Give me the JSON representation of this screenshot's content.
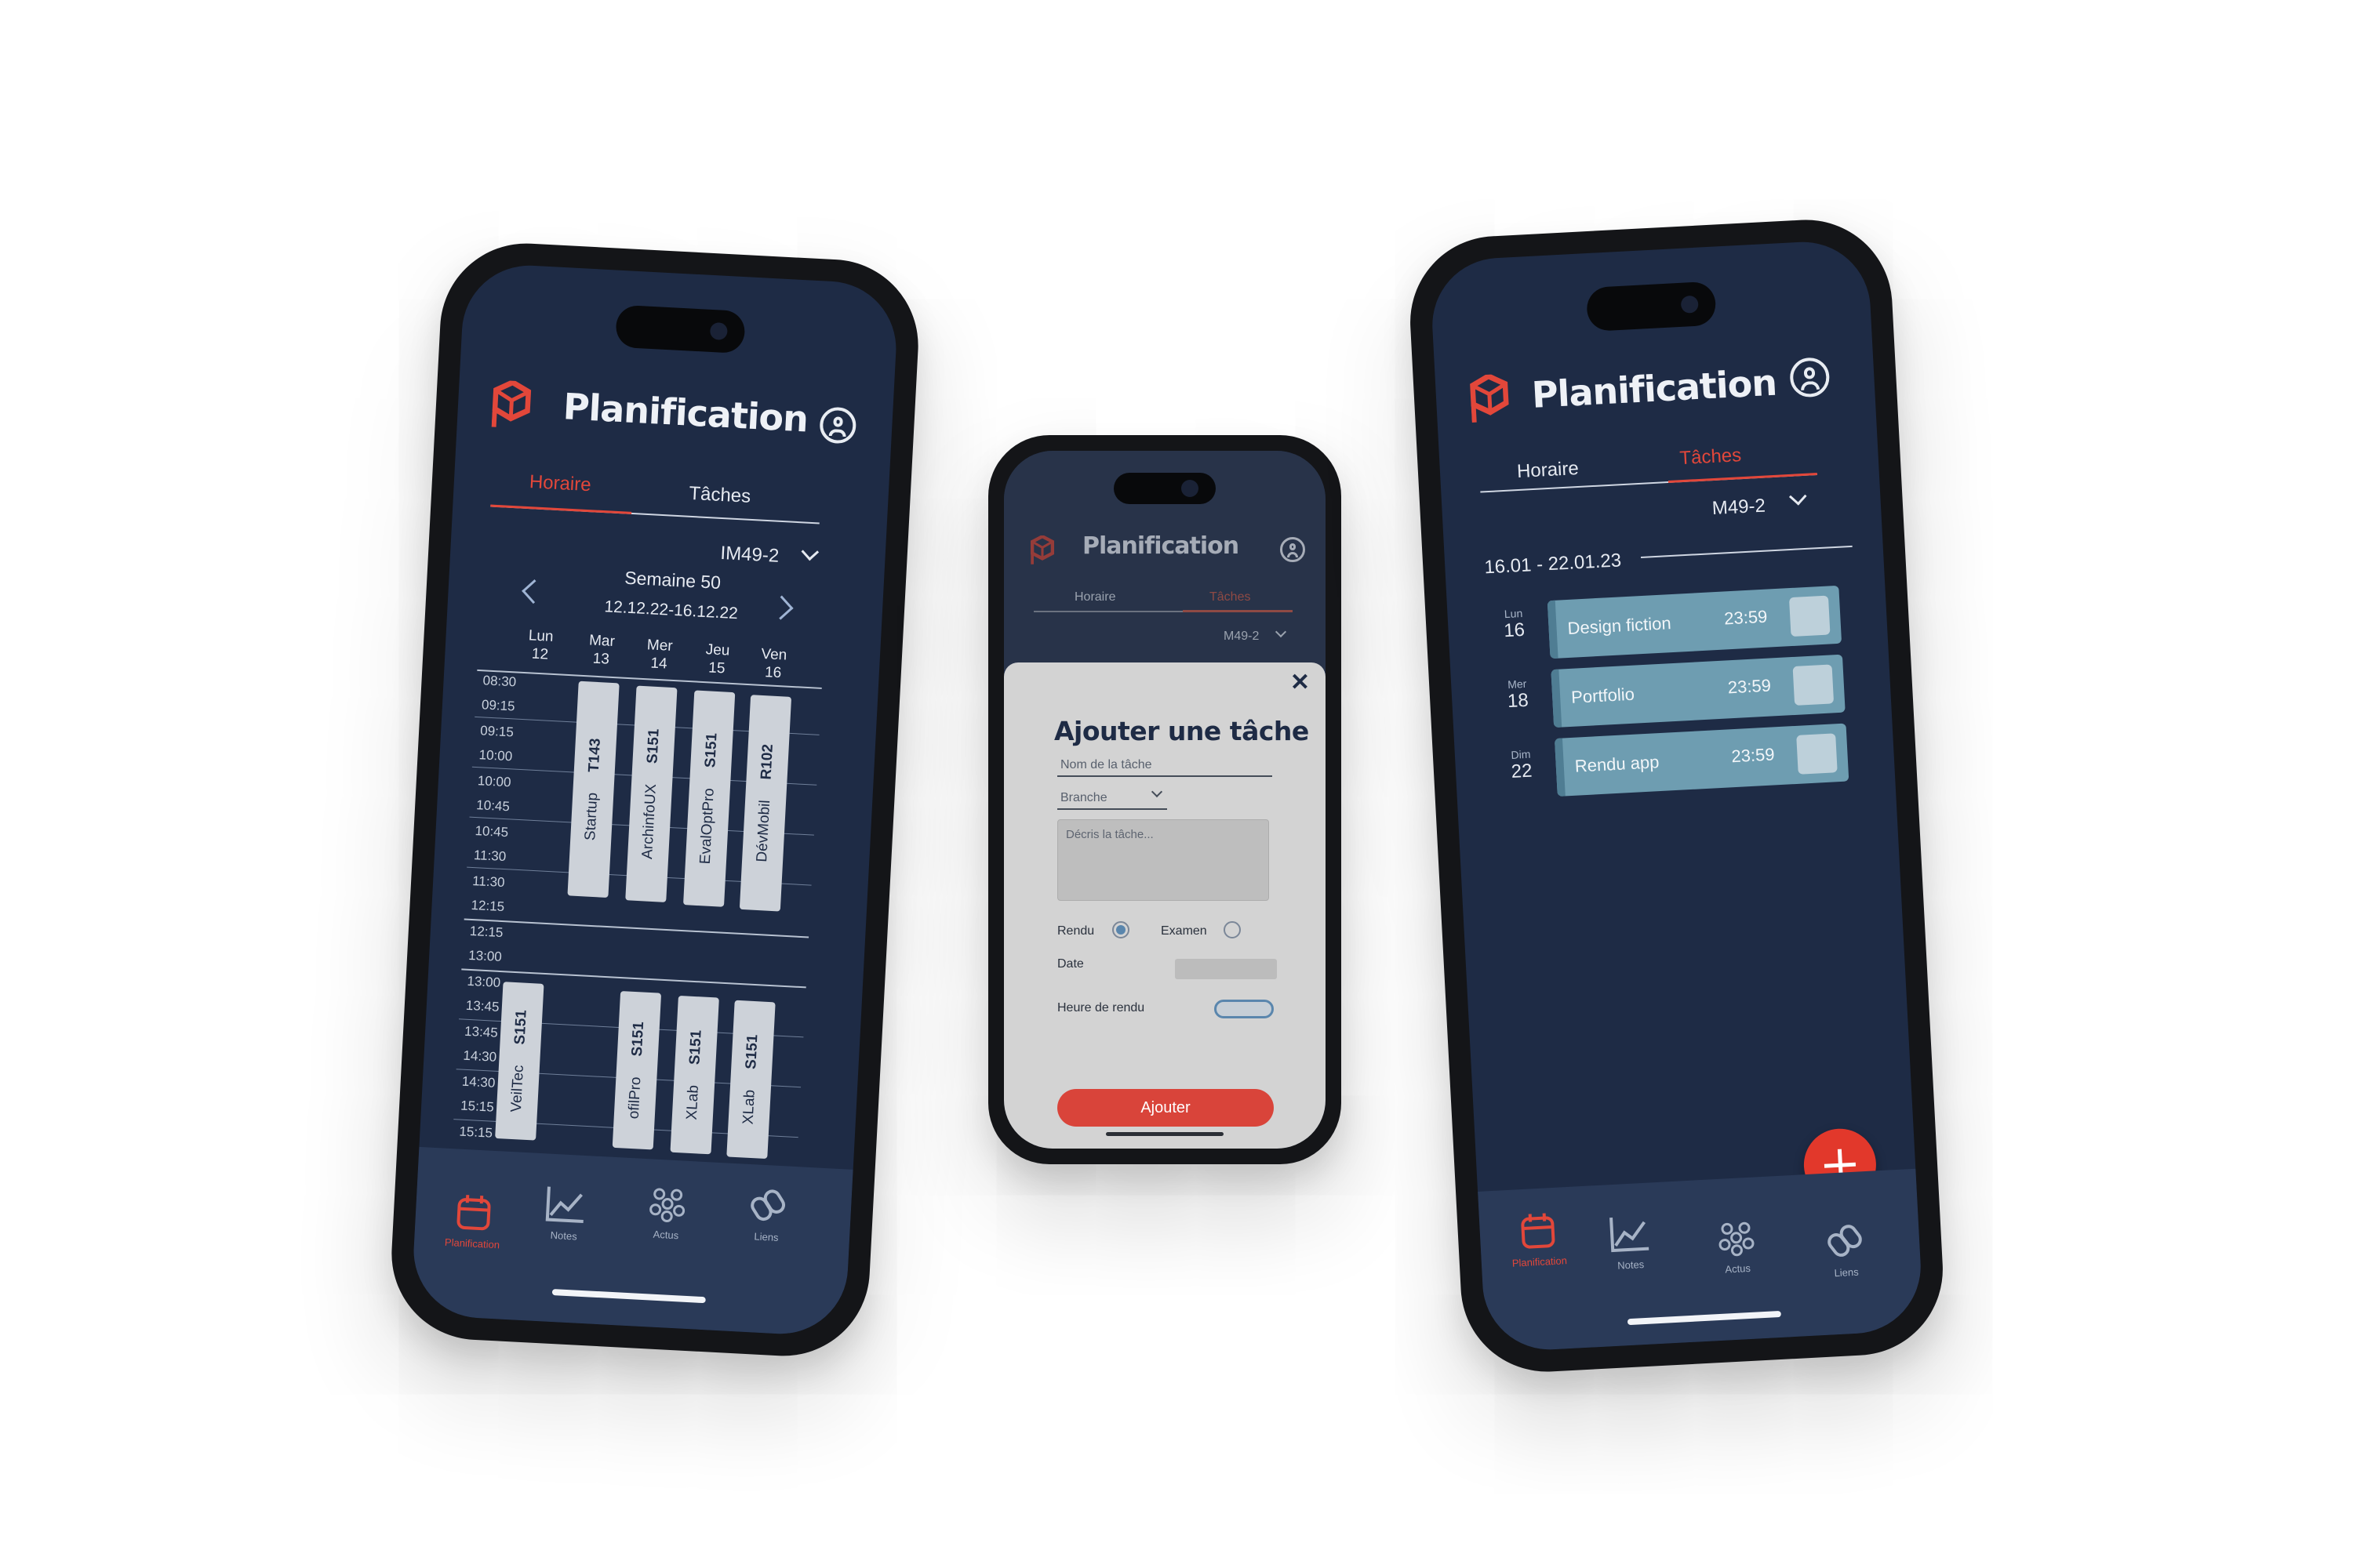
{
  "app": {
    "title": "Planification",
    "brand_color": "#e2473a",
    "background_color": "#1e2b45",
    "logo_icon": "cube-logo-icon",
    "profile_icon": "profile-icon"
  },
  "tabs": {
    "horaire": "Horaire",
    "taches": "Tâches"
  },
  "class_select": {
    "value": "IM49-2",
    "value_right": "M49-2"
  },
  "schedule": {
    "week_label": "Semaine 50",
    "date_range": "12.12.22-16.12.22",
    "days": [
      {
        "name": "Lun",
        "num": "12"
      },
      {
        "name": "Mar",
        "num": "13"
      },
      {
        "name": "Mer",
        "num": "14"
      },
      {
        "name": "Jeu",
        "num": "15"
      },
      {
        "name": "Ven",
        "num": "16"
      }
    ],
    "times": [
      "08:30",
      "09:15",
      "09:15",
      "10:00",
      "10:00",
      "10:45",
      "10:45",
      "11:30",
      "11:30",
      "12:15",
      "12:15",
      "13:00",
      "13:00",
      "13:45",
      "13:45",
      "14:30",
      "14:30",
      "15:15",
      "15:15"
    ],
    "courses": [
      {
        "name": "Startup",
        "room": "T143"
      },
      {
        "name": "ArchinfoUX",
        "room": "S151"
      },
      {
        "name": "EvalOptPro",
        "room": "S151"
      },
      {
        "name": "DévMobil",
        "room": "R102"
      },
      {
        "name": "VeilTec",
        "room": "S151"
      },
      {
        "name": "ofilPro",
        "room": "S151"
      },
      {
        "name": "XLab",
        "room": "S151"
      },
      {
        "name": "XLab",
        "room": "S151"
      }
    ]
  },
  "modal": {
    "title": "Ajouter une tâche",
    "name_placeholder": "Nom de la tâche",
    "branch_placeholder": "Branche",
    "description_placeholder": "Décris la tâche...",
    "type_rendu": "Rendu",
    "type_examen": "Examen",
    "date_label": "Date",
    "time_label": "Heure de rendu",
    "submit": "Ajouter"
  },
  "tasks": {
    "range": "16.01 - 22.01.23",
    "items": [
      {
        "day_name": "Lun",
        "day_num": "16",
        "name": "Design fiction",
        "time": "23:59"
      },
      {
        "day_name": "Mer",
        "day_num": "18",
        "name": "Portfolio",
        "time": "23:59"
      },
      {
        "day_name": "Dim",
        "day_num": "22",
        "name": "Rendu app",
        "time": "23:59"
      }
    ]
  },
  "tabbar": {
    "planification": "Planification",
    "notes": "Notes",
    "actus": "Actus",
    "liens": "Liens"
  }
}
